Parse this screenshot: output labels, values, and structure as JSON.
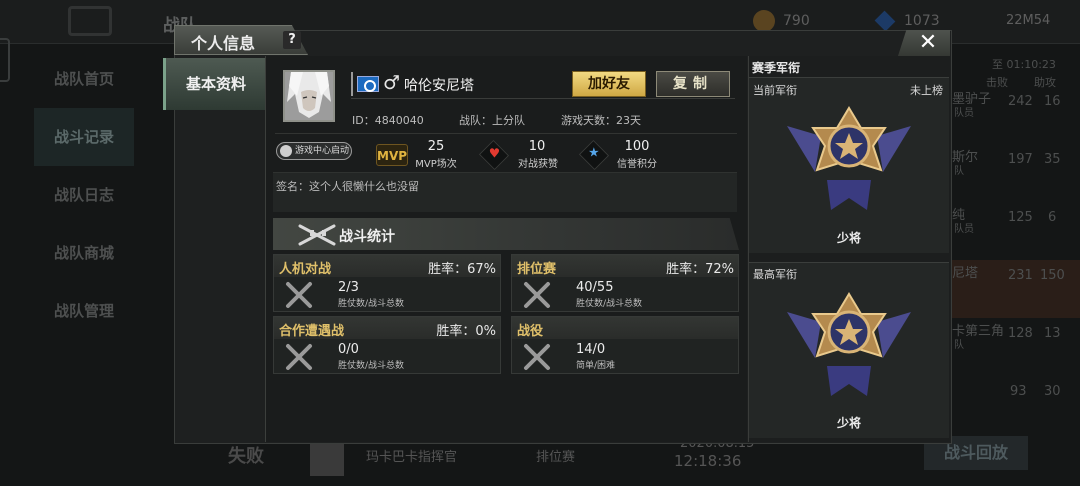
{
  "background": {
    "screen_title": "战队",
    "coins": "790",
    "gems": "1073",
    "clock": "22M54",
    "side_menu": [
      "战队首页",
      "战斗记录",
      "战队日志",
      "战队商城",
      "战队管理"
    ],
    "right_header": "至 01:10:23",
    "right_cols": [
      "击败",
      "助攻"
    ],
    "right_rows": [
      {
        "name": "墨驴子",
        "sub": "队员",
        "kills": "242",
        "assists": "16"
      },
      {
        "name": "斯尔",
        "sub": "队",
        "kills": "197",
        "assists": "35"
      },
      {
        "name": "纯",
        "sub": "队员",
        "kills": "125",
        "assists": "6"
      },
      {
        "name": "尼塔",
        "sub": "",
        "kills": "231",
        "assists": "150"
      },
      {
        "name": "卡第三角",
        "sub": "队",
        "kills": "128",
        "assists": "13"
      },
      {
        "name": "",
        "sub": "",
        "kills": "93",
        "assists": "30"
      }
    ],
    "bottom_result": "失败",
    "bottom_map": "玛卡巴卡指挥官",
    "bottom_mode": "排位赛",
    "bottom_date": "2020.08.15",
    "bottom_time": "12:18:36",
    "fight_replay_button": "战斗回放"
  },
  "modal": {
    "title": "个人信息",
    "help": "?",
    "close": "✕",
    "left_tab": "基本资料",
    "player": {
      "name": "哈伦安尼塔",
      "gender_symbol": "♂",
      "id_text": "ID：4840040",
      "team_text": "战队：上分队",
      "days_text": "游戏天数：23天",
      "signature": "签名：这个人很懒什么也没留"
    },
    "buttons": {
      "add_friend": "加好友",
      "copy": "复制"
    },
    "game_center": "游戏中心启动",
    "stats": [
      {
        "icon": "mvp-icon",
        "value": "25",
        "label": "MVP场次"
      },
      {
        "icon": "heart-icon",
        "value": "10",
        "label": "对战获赞"
      },
      {
        "icon": "star-icon",
        "value": "100",
        "label": "信誉积分"
      }
    ],
    "mvp_text": "MVP",
    "battle_stats": {
      "title": "战斗统计",
      "cards": [
        {
          "title": "人机对战",
          "rate": "胜率：67%",
          "value": "2/3",
          "sub": "胜仗数/战斗总数"
        },
        {
          "title": "排位赛",
          "rate": "胜率：72%",
          "value": "40/55",
          "sub": "胜仗数/战斗总数"
        },
        {
          "title": "合作遭遇战",
          "rate": "胜率：0%",
          "value": "0/0",
          "sub": "胜仗数/战斗总数"
        },
        {
          "title": "战役",
          "rate": "",
          "value": "14/0",
          "sub": "简单/困难"
        }
      ]
    },
    "rank": {
      "title": "赛季军衔",
      "current_label": "当前军衔",
      "current_status": "未上榜",
      "current_rank": "少将",
      "highest_label": "最高军衔",
      "highest_rank": "少将"
    }
  }
}
